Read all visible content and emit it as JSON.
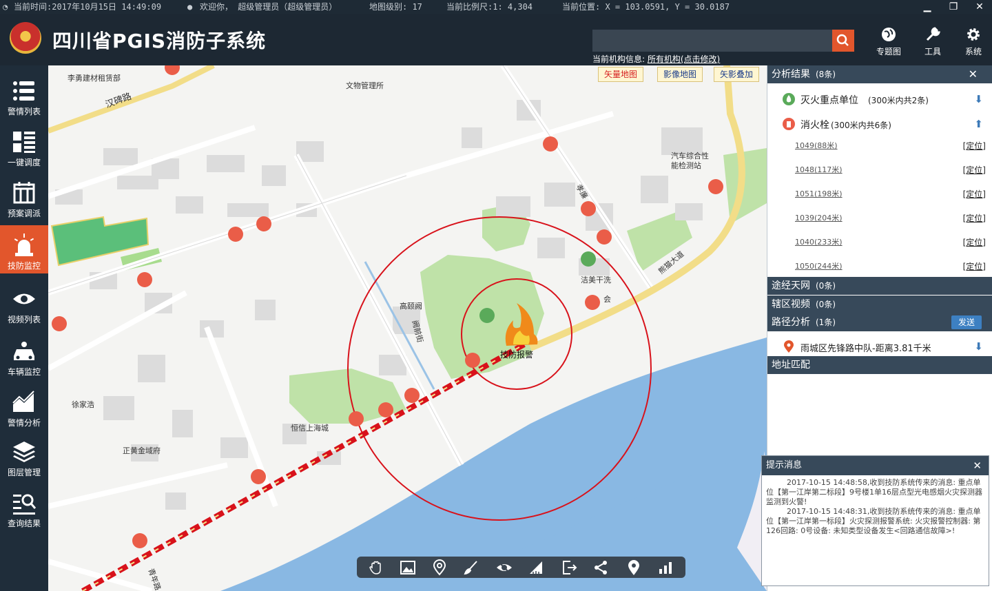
{
  "status_bar": {
    "time": "当前时间:2017年10月15日 14:49:09",
    "welcome": "欢迎你， 超级管理员（超级管理员）",
    "map_level": "地图级别: 17",
    "scale": "当前比例尺:1: 4,304",
    "position": "当前位置: X = 103.0591, Y = 30.0187"
  },
  "header": {
    "title": "四川省PGIS消防子系统",
    "search_placeholder": "",
    "org_label": "当前机构信息:",
    "org_link": "所有机构(点击修改)",
    "buttons": [
      {
        "label": "专题图",
        "icon": "globe-icon"
      },
      {
        "label": "工具",
        "icon": "wrench-icon"
      },
      {
        "label": "系统",
        "icon": "gear-icon"
      }
    ]
  },
  "sidebar": {
    "items": [
      {
        "label": "警情列表",
        "icon": "list-icon"
      },
      {
        "label": "一键调度",
        "icon": "grid-list-icon"
      },
      {
        "label": "预案调派",
        "icon": "calendar-icon"
      },
      {
        "label": "技防监控",
        "icon": "alarm-light-icon",
        "active": true
      },
      {
        "label": "视频列表",
        "icon": "eye-icon"
      },
      {
        "label": "车辆监控",
        "icon": "vehicle-icon"
      },
      {
        "label": "警情分析",
        "icon": "area-chart-icon"
      },
      {
        "label": "图层管理",
        "icon": "layers-icon"
      },
      {
        "label": "查询结果",
        "icon": "search-list-icon"
      }
    ]
  },
  "map": {
    "tabs": [
      "矢量地图",
      "影像地图",
      "矢影叠加"
    ],
    "active_tab": "矢量地图",
    "labels": {
      "a": "李勇建材租赁部",
      "b": "汉碑路",
      "c": "文物管理所",
      "d": "高颐阙",
      "e": "阙前街",
      "f": "洁美干洗",
      "g": "汽车综合性能检测站",
      "h": "熊猫大道",
      "i": "徐家浩",
      "j": "恒信上海城",
      "k": "正黄金域府",
      "l": "青年路",
      "m": "孝廉",
      "n": "会"
    },
    "incident_label": "技防报警",
    "toolbar_icons": [
      "hand-icon",
      "image-icon",
      "map-pin-icon",
      "brush-icon",
      "eye-icon",
      "ruler-icon",
      "export-icon",
      "share-icon",
      "location-icon",
      "bar-chart-icon"
    ]
  },
  "right_panel": {
    "analysis": {
      "title": "分析结果",
      "count": "(8条)"
    },
    "key_units": {
      "label": "灭火重点单位",
      "detail": "(300米内共2条)"
    },
    "hydrants": {
      "label": "消火栓",
      "detail": "(300米内共6条)",
      "items": [
        "1049(88米)",
        "1048(117米)",
        "1051(198米)",
        "1039(204米)",
        "1040(233米)",
        "1050(244米)"
      ],
      "locate_label": "[定位]"
    },
    "net": {
      "title": "途经天网",
      "count": "(0条)"
    },
    "video": {
      "title": "辖区视频",
      "count": "(0条)"
    },
    "route": {
      "title": "路径分析",
      "count": "(1条)",
      "send": "发送"
    },
    "route_item": "雨城区先锋路中队-距离3.81千米",
    "address": {
      "title": "地址匹配"
    }
  },
  "messages": {
    "title": "提示消息",
    "items": [
      "2017-10-15 14:48:58,收到技防系统传来的消息: 重点单位【第一江岸第二标段】9号楼1单16层点型光电感烟火灾探测器监测到火警!",
      "2017-10-15 14:48:31,收到技防系统传来的消息: 重点单位【第一江岸第一标段】火灾探测报警系统: 火灾报警控制器: 第126回路: 0号设备: 未知类型设备发生<回路通信故障>!"
    ]
  },
  "colors": {
    "accent": "#e2562c",
    "header": "#1d2833",
    "panel_head": "#37495a",
    "river": "#89b8e3",
    "green": "#bfe2a8",
    "alarm_ring": "#d8121b"
  }
}
